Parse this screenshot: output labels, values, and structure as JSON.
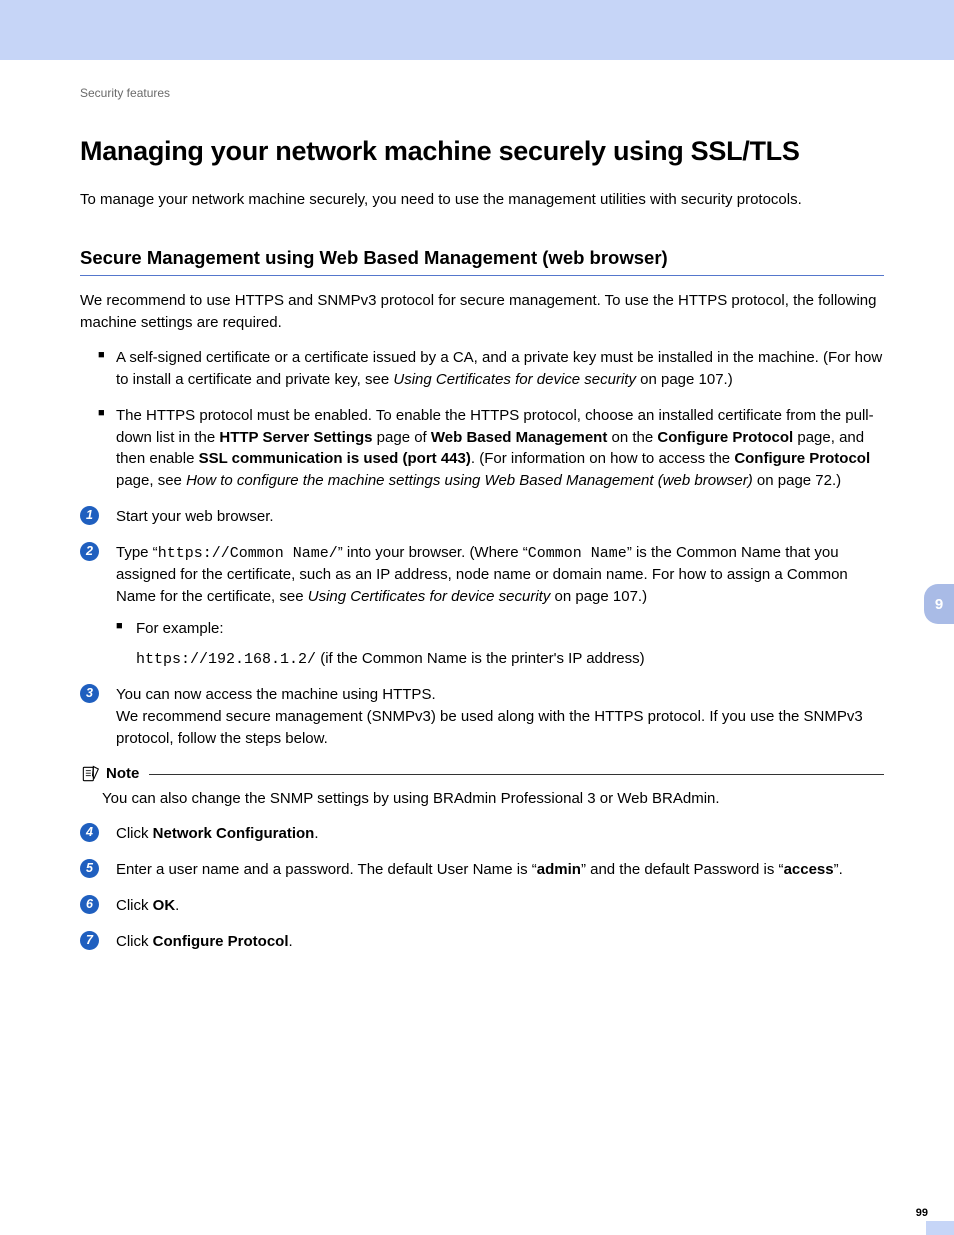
{
  "breadcrumb": "Security features",
  "h1": "Managing your network machine securely using SSL/TLS",
  "intro": "To manage your network machine securely, you need to use the management utilities with security protocols.",
  "h2": "Secure Management using Web Based Management (web browser)",
  "recommend": "We recommend to use HTTPS and SNMPv3 protocol for secure management. To use the HTTPS protocol, the following machine settings are required.",
  "bullets": {
    "b1_a": "A self-signed certificate or a certificate issued by a CA, and a private key must be installed in the machine. (For how to install a certificate and private key, see ",
    "b1_link": "Using Certificates for device security",
    "b1_b": " on page 107.)",
    "b2_a": "The HTTPS protocol must be enabled. To enable the HTTPS protocol, choose an installed certificate from the pull-down list in the ",
    "b2_bold1": "HTTP Server Settings",
    "b2_b": " page of ",
    "b2_bold2": "Web Based Management",
    "b2_c": " on the ",
    "b2_bold3": "Configure Protocol",
    "b2_d": " page, and then enable ",
    "b2_bold4": "SSL communication is used (port 443)",
    "b2_e": ". (For information on how to access the ",
    "b2_bold5": "Configure Protocol",
    "b2_f": " page, see ",
    "b2_link": "How to configure the machine settings using Web Based Management (web browser)",
    "b2_g": " on page 72.)"
  },
  "steps": {
    "s1": "Start your web browser.",
    "s2_a": "Type “",
    "s2_code1": "https://Common Name/",
    "s2_b": "” into your browser. (Where “",
    "s2_code2": "Common Name",
    "s2_c": "” is the Common Name that you assigned for the certificate, such as an IP address, node name or domain name. For how to assign a Common Name for the certificate, see ",
    "s2_link": "Using Certificates for device security",
    "s2_d": " on page 107.)",
    "s2_example_label": "For example:",
    "s2_example_code": "https://192.168.1.2/",
    "s2_example_tail": " (if the Common Name is the printer's IP address)",
    "s3_a": "You can now access the machine using HTTPS.",
    "s3_b": "We recommend secure management (SNMPv3) be used along with the HTTPS protocol. If you use the SNMPv3 protocol, follow the steps below.",
    "s4_a": "Click ",
    "s4_bold": "Network Configuration",
    "s4_b": ".",
    "s5_a": "Enter a user name and a password. The default User Name is “",
    "s5_bold1": "admin",
    "s5_b": "” and the default Password is “",
    "s5_bold2": "access",
    "s5_c": "”.",
    "s6_a": "Click ",
    "s6_bold": "OK",
    "s6_b": ".",
    "s7_a": "Click ",
    "s7_bold": "Configure Protocol",
    "s7_b": "."
  },
  "note": {
    "title": "Note",
    "body": "You can also change the SNMP settings by using BRAdmin Professional 3 or Web BRAdmin."
  },
  "side_tab": "9",
  "page_number": "99"
}
